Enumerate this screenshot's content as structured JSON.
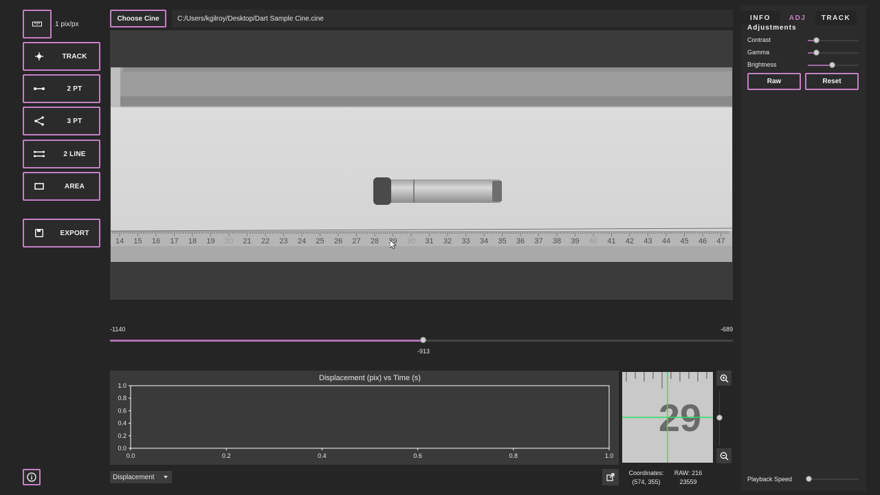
{
  "toolbar": {
    "scale_label": "1 pix/px",
    "buttons": [
      {
        "label": "TRACK",
        "icon": "crosshair-icon"
      },
      {
        "label": "2 PT",
        "icon": "line-two-points-icon"
      },
      {
        "label": "3 PT",
        "icon": "angle-three-points-icon"
      },
      {
        "label": "2 LINE",
        "icon": "two-lines-icon"
      },
      {
        "label": "AREA",
        "icon": "rectangle-area-icon"
      },
      {
        "label": "EXPORT",
        "icon": "save-icon"
      }
    ]
  },
  "topbar": {
    "choose_label": "Choose Cine",
    "file_path": "C:/Users/kgilroy/Desktop/Dart Sample Cine.cine"
  },
  "frame": {
    "ruler_numbers": [
      "14",
      "15",
      "16",
      "17",
      "18",
      "19",
      "20",
      "21",
      "22",
      "23",
      "24",
      "25",
      "26",
      "27",
      "28",
      "29",
      "30",
      "31",
      "32",
      "33",
      "34",
      "35",
      "36",
      "37",
      "38",
      "39",
      "40",
      "41",
      "42",
      "43",
      "44",
      "45",
      "46",
      "47"
    ]
  },
  "timeline": {
    "min_label": "-1140",
    "max_label": "-689",
    "current_label": "-913",
    "min": -1140,
    "max": -689,
    "value": -913
  },
  "chart_data": {
    "type": "line",
    "title": "Displacement (pix) vs Time (s)",
    "xlabel": "",
    "ylabel": "",
    "xlim": [
      0.0,
      1.0
    ],
    "ylim": [
      0.0,
      1.0
    ],
    "x_ticks": [
      "0.0",
      "0.2",
      "0.4",
      "0.6",
      "0.8",
      "1.0"
    ],
    "y_ticks": [
      "0.0",
      "0.2",
      "0.4",
      "0.6",
      "0.8",
      "1.0"
    ],
    "series": []
  },
  "plot_controls": {
    "dropdown_value": "Displacement"
  },
  "magnifier": {
    "number": "29"
  },
  "coordinates": {
    "label": "Coordinates:",
    "value": "(574, 355)",
    "raw_label": "RAW: 216",
    "raw_value": "23559"
  },
  "right_panel": {
    "tabs": [
      {
        "label": "INFO",
        "active": false
      },
      {
        "label": "ADJ",
        "active": true
      },
      {
        "label": "TRACK",
        "active": false
      }
    ],
    "section_title": "Adjustments",
    "sliders": [
      {
        "label": "Contrast",
        "level": 0.17
      },
      {
        "label": "Gamma",
        "level": 0.18
      },
      {
        "label": "Brightness",
        "level": 0.49
      }
    ],
    "raw_label": "Raw",
    "reset_label": "Reset",
    "playback_label": "Playback Speed",
    "playback_level": 0.0
  },
  "colors": {
    "accent": "#c780c7",
    "background": "#252525",
    "crosshair": "#33dd66"
  }
}
